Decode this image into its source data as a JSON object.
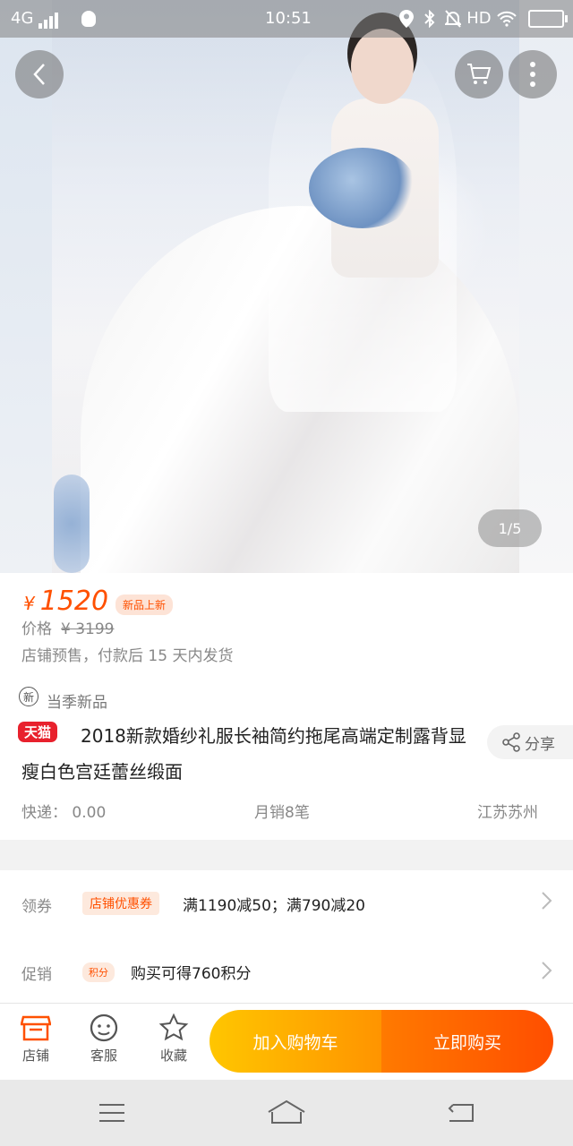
{
  "status_bar": {
    "network": "4G",
    "time": "10:51",
    "hd": "HD"
  },
  "gallery": {
    "page_indicator": "1/5"
  },
  "product": {
    "currency": "¥",
    "price": "1520",
    "new_tag": "新品上新",
    "orig_label": "价格",
    "orig_price": "¥ 3199",
    "presale_note": "店铺预售，付款后 15 天内发货",
    "new_item_icon": "新",
    "new_item_label": "当季新品",
    "tmall_badge": "天猫",
    "title": "2018新款婚纱礼服长袖简约拖尾高端定制露背显瘦白色宫廷蕾丝缎面",
    "share_label": "分享",
    "shipping": "快递： 0.00",
    "monthly_sales": "月销8笔",
    "location": "江苏苏州"
  },
  "promotions": {
    "coupon_label": "领券",
    "coupon_tag": "店铺优惠券",
    "coupon_text": "满1190减50；满790减20",
    "promo_label": "促销",
    "points_tag": "积分",
    "points_text": "购买可得760积分"
  },
  "bottom_bar": {
    "store": "店铺",
    "service": "客服",
    "favorite": "收藏",
    "add_to_cart": "加入购物车",
    "buy_now": "立即购买"
  },
  "colors": {
    "accent": "#ff5000",
    "cart_button": "#ffa000",
    "tmall_red": "#e8212d"
  },
  "icons": [
    "back-icon",
    "cart-icon",
    "more-icon",
    "share-icon",
    "store-icon",
    "service-icon",
    "star-icon",
    "chevron-right-icon",
    "menu-icon",
    "home-icon",
    "return-icon"
  ]
}
